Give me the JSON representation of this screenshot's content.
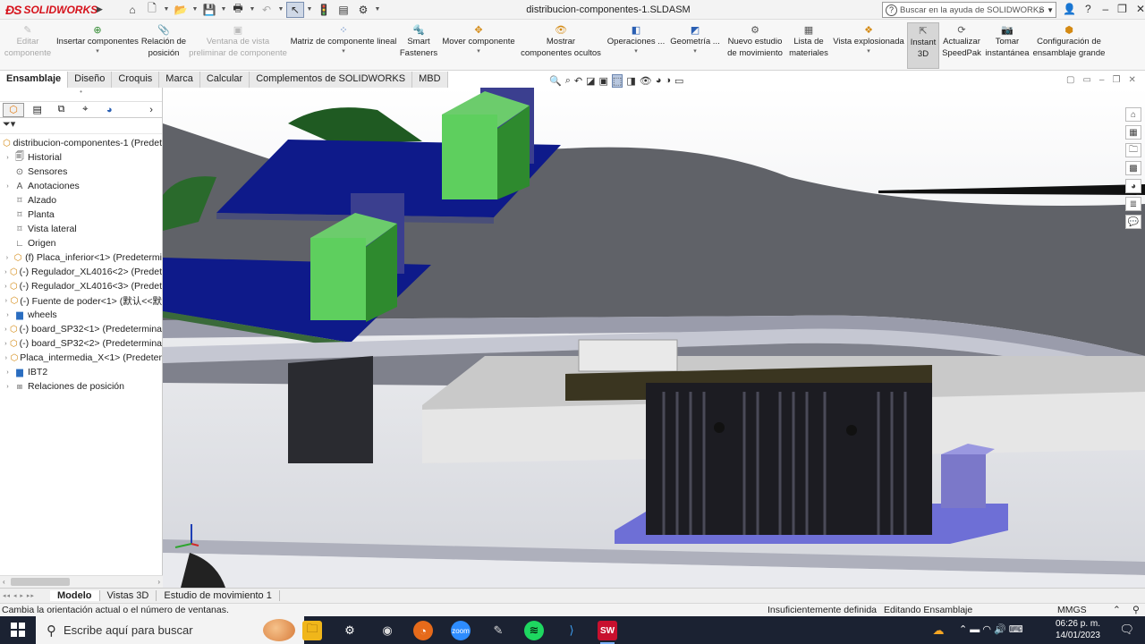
{
  "app": {
    "brand": "SOLIDWORKS",
    "document_title": "distribucion-componentes-1.SLDASM",
    "help_search_placeholder": "Buscar en la ayuda de SOLIDWORKS"
  },
  "ribbon": {
    "edit_component": "Editar componente",
    "insert_components": "Insertar componentes",
    "mate": "Relación de posición",
    "preview_window": "Ventana de vista preliminar de componente",
    "linear_pattern": "Matriz de componente lineal",
    "smart_fasteners": "Smart Fasteners",
    "move_component": "Mover componente",
    "show_hidden": "Mostrar componentes ocultos",
    "operations": "Operaciones ...",
    "geometry": "Geometría ...",
    "new_motion": "Nuevo estudio de movimiento",
    "bom": "Lista de materiales",
    "exploded": "Vista explosionada",
    "instant3d": "Instant 3D",
    "speedpak": "Actualizar SpeedPak",
    "snapshot": "Tomar instantánea",
    "large_assembly": "Configuración de ensamblaje grande"
  },
  "tabs": [
    "Ensamblaje",
    "Diseño",
    "Croquis",
    "Marca",
    "Calcular",
    "Complementos de SOLIDWORKS",
    "MBD"
  ],
  "tree": {
    "root": "distribucion-componentes-1  (Predet",
    "items": [
      {
        "label": "Historial",
        "icon": "history-icon",
        "expand": true
      },
      {
        "label": "Sensores",
        "icon": "sensor-icon",
        "expand": false
      },
      {
        "label": "Anotaciones",
        "icon": "annotation-icon",
        "expand": true
      },
      {
        "label": "Alzado",
        "icon": "plane-icon",
        "expand": false
      },
      {
        "label": "Planta",
        "icon": "plane-icon",
        "expand": false
      },
      {
        "label": "Vista lateral",
        "icon": "plane-icon",
        "expand": false
      },
      {
        "label": "Origen",
        "icon": "origin-icon",
        "expand": false
      },
      {
        "label": "(f) Placa_inferior<1> (Predetermi",
        "icon": "part-icon",
        "expand": true
      },
      {
        "label": "(-) Regulador_XL4016<2> (Predet",
        "icon": "part-icon",
        "expand": true
      },
      {
        "label": "(-) Regulador_XL4016<3> (Predet",
        "icon": "part-icon",
        "expand": true
      },
      {
        "label": "(-) Fuente de poder<1> (默认<<默",
        "icon": "part-icon",
        "expand": true
      },
      {
        "label": "wheels",
        "icon": "folder-icon",
        "expand": true
      },
      {
        "label": "(-) board_SP32<1> (Predetermina",
        "icon": "part-icon",
        "expand": true
      },
      {
        "label": "(-) board_SP32<2> (Predetermina",
        "icon": "part-icon",
        "expand": true
      },
      {
        "label": "Placa_intermedia_X<1> (Predeter",
        "icon": "part-icon",
        "expand": true
      },
      {
        "label": "IBT2",
        "icon": "folder-icon",
        "expand": true
      },
      {
        "label": "Relaciones de posición",
        "icon": "mates-icon",
        "expand": true
      }
    ]
  },
  "bottom_tabs": [
    "Modelo",
    "Vistas 3D",
    "Estudio de movimiento 1"
  ],
  "status": {
    "message": "Cambia la orientación actual o el número de ventanas.",
    "definition": "Insuficientemente definida",
    "mode": "Editando Ensamblaje",
    "units": "MMGS"
  },
  "taskbar": {
    "search_placeholder": "Escribe aquí para buscar",
    "time": "06:26 p. m.",
    "date": "14/01/2023"
  }
}
